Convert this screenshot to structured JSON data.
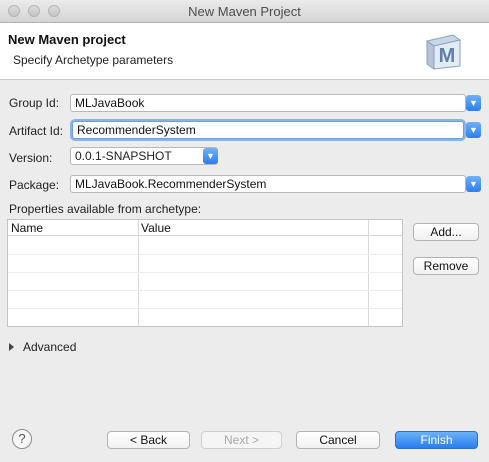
{
  "window": {
    "title": "New Maven Project"
  },
  "header": {
    "title": "New Maven project",
    "subtitle": "Specify Archetype parameters",
    "logo_letter": "M"
  },
  "form": {
    "group_id": {
      "label": "Group Id:",
      "value": "MLJavaBook"
    },
    "artifact_id": {
      "label": "Artifact Id:",
      "value": "RecommenderSystem"
    },
    "version": {
      "label": "Version:",
      "value": "0.0.1-SNAPSHOT"
    },
    "package": {
      "label": "Package:",
      "value": "MLJavaBook.RecommenderSystem"
    }
  },
  "properties": {
    "label": "Properties available from archetype:",
    "columns": [
      "Name",
      "Value"
    ],
    "add_label": "Add...",
    "remove_label": "Remove"
  },
  "advanced": {
    "label": "Advanced"
  },
  "footer": {
    "help_label": "?",
    "back_label": "< Back",
    "next_label": "Next >",
    "cancel_label": "Cancel",
    "finish_label": "Finish"
  },
  "colors": {
    "accent": "#2a7df0",
    "focus_ring": "#8cb2e6"
  }
}
